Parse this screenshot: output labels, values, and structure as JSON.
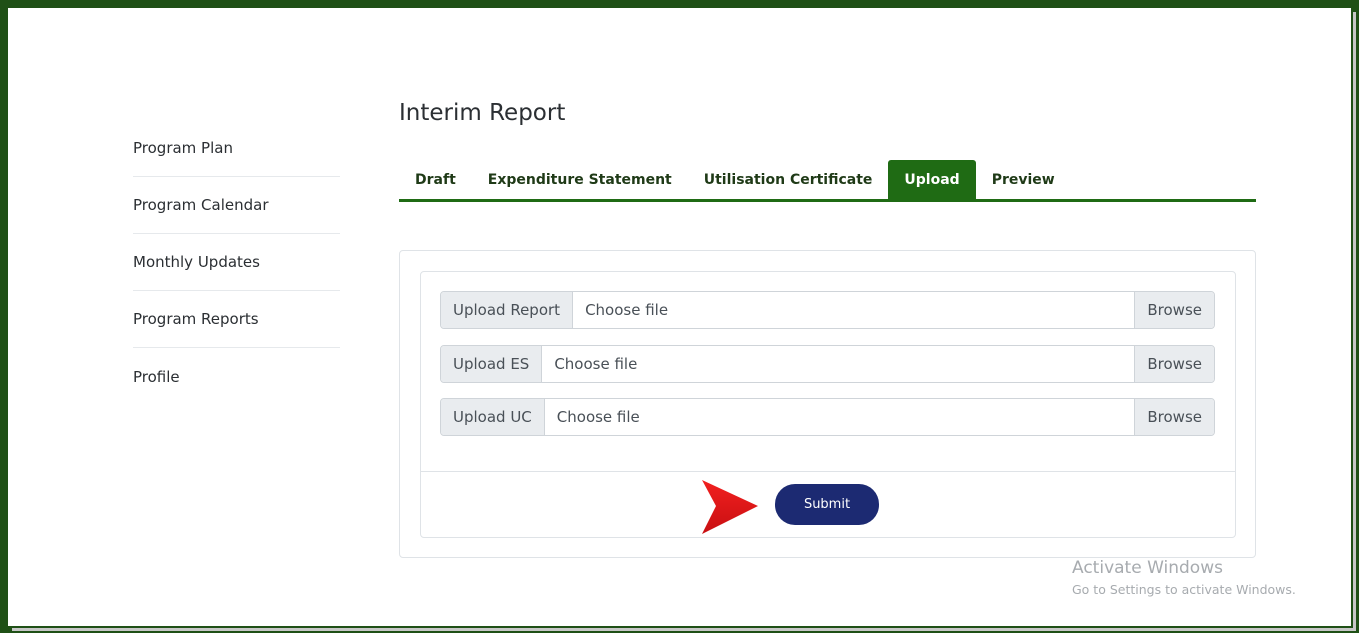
{
  "sidebar": {
    "items": [
      {
        "label": "Program Plan"
      },
      {
        "label": "Program Calendar"
      },
      {
        "label": "Monthly Updates"
      },
      {
        "label": "Program Reports"
      },
      {
        "label": "Profile"
      }
    ]
  },
  "main": {
    "title": "Interim Report",
    "tabs": [
      {
        "label": "Draft",
        "active": false
      },
      {
        "label": "Expenditure Statement",
        "active": false
      },
      {
        "label": "Utilisation Certificate",
        "active": false
      },
      {
        "label": "Upload",
        "active": true
      },
      {
        "label": "Preview",
        "active": false
      }
    ],
    "uploads": [
      {
        "label": "Upload Report",
        "placeholder": "Choose file",
        "browse": "Browse"
      },
      {
        "label": "Upload ES",
        "placeholder": "Choose file",
        "browse": "Browse"
      },
      {
        "label": "Upload UC",
        "placeholder": "Choose file",
        "browse": "Browse"
      }
    ],
    "submit_label": "Submit"
  },
  "annotation": {
    "icon": "red-arrow-icon",
    "color": "#e8141b"
  },
  "watermark": {
    "title": "Activate Windows",
    "subtitle": "Go to Settings to activate Windows."
  },
  "colors": {
    "frame": "#1f5016",
    "accent": "#1f6b14",
    "submit": "#1c2a72"
  }
}
